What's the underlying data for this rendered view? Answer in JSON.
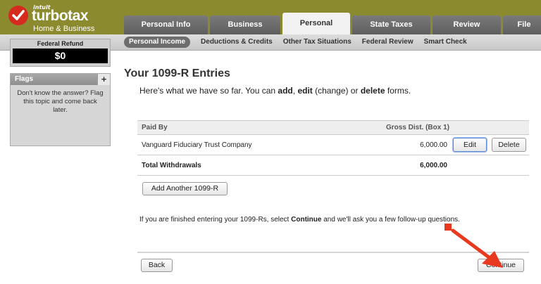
{
  "logo": {
    "company": "intuit",
    "brand": "turbotax",
    "edition": "Home & Business"
  },
  "tabs": [
    {
      "label": "Personal Info",
      "active": false
    },
    {
      "label": "Business",
      "active": false
    },
    {
      "label": "Personal",
      "active": true
    },
    {
      "label": "State Taxes",
      "active": false
    },
    {
      "label": "Review",
      "active": false
    },
    {
      "label": "File",
      "active": false
    }
  ],
  "subnav": [
    {
      "label": "Personal Income",
      "active": true
    },
    {
      "label": "Deductions & Credits",
      "active": false
    },
    {
      "label": "Other Tax Situations",
      "active": false
    },
    {
      "label": "Federal Review",
      "active": false
    },
    {
      "label": "Smart Check",
      "active": false
    }
  ],
  "refund": {
    "label": "Federal Refund",
    "amount": "$0"
  },
  "flags": {
    "title": "Flags",
    "add_label": "+",
    "text": "Don't know the answer? Flag this topic and come back later."
  },
  "main": {
    "title": "Your 1099-R Entries",
    "intro": {
      "prefix": "Here's what we have so far. You can ",
      "add": "add",
      "sep1": ", ",
      "edit": "edit",
      "mid": " (change) or ",
      "delete": "delete",
      "suffix": " forms."
    },
    "table": {
      "headers": {
        "paid_by": "Paid By",
        "gross": "Gross Dist. (Box 1)"
      },
      "rows": [
        {
          "paid_by": "Vanguard Fiduciary Trust Company",
          "gross": "6,000.00",
          "edit_label": "Edit",
          "delete_label": "Delete"
        }
      ],
      "total": {
        "label": "Total Withdrawals",
        "value": "6,000.00"
      }
    },
    "add_another_label": "Add Another 1099-R",
    "note": {
      "prefix": "If you are finished entering your 1099-Rs, select ",
      "bold": "Continue",
      "suffix": " and we'll ask you a few follow-up questions."
    },
    "back_label": "Back",
    "continue_label": "Continue"
  },
  "colors": {
    "topbar": "#8c8a2f",
    "annotation": "#e8391f",
    "logo_check": "#d52b1e"
  }
}
